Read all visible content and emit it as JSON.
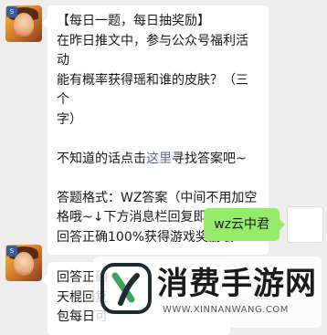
{
  "messages": {
    "first": {
      "lines": [
        "【每日一题，每日抽奖励】",
        "在昨日推文中，参与公众号福利活动",
        "能有概率获得瑶和谁的皮肤？（三个",
        "字）"
      ],
      "hint_prefix": "不知道的话点击",
      "hint_link": "这里",
      "hint_suffix": "寻找答案吧~",
      "format_lines": [
        "答题格式：WZ答案（中间不用加空",
        "格哦~↓下方消息栏回复即可",
        "回答正确100%获得游戏奖励哦！"
      ]
    },
    "reply": {
      "text": "wz云中君"
    },
    "second": {
      "lines": [
        "回答正确",
        "天棍回复",
        "包每日可"
      ]
    }
  },
  "watermark": {
    "title": "消费手游网",
    "url": "WWW.XINNANWANG.COM"
  },
  "colors": {
    "background": "#ededed",
    "bubble": "#ffffff",
    "my_bubble": "#95ec69",
    "link": "#576b95"
  }
}
